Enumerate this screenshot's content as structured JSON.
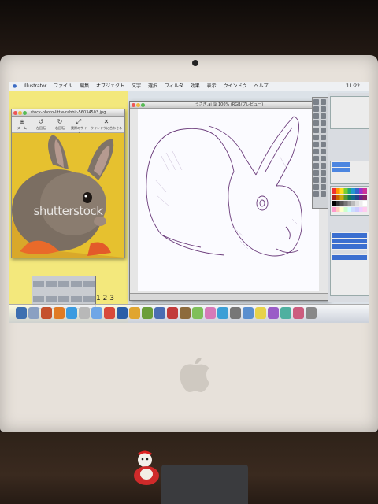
{
  "menubar": {
    "app_name": "Illustrator",
    "items": [
      "ファイル",
      "編集",
      "オブジェクト",
      "文字",
      "選択",
      "フィルタ",
      "効果",
      "表示",
      "ウインドウ",
      "ヘルプ"
    ],
    "clock": "11:22"
  },
  "photo_window": {
    "title": "stock-photo-little-rabbit-56034503.jpg",
    "toolbar_labels": [
      "ズーム",
      "左回転",
      "右回転",
      "実際のサイズ",
      "ウインドウに合わせる"
    ],
    "watermark": "shutterstock"
  },
  "artboard_window": {
    "title": "うさぎ.ai @ 100% (RGB/プレビュー)"
  },
  "page_numbers": [
    "1",
    "2",
    "3"
  ],
  "dock": {
    "icon_colors": [
      "#3d6fb0",
      "#8aa0c2",
      "#c5512c",
      "#e07b24",
      "#3b9be0",
      "#b8b8b8",
      "#6fa6e6",
      "#d84a3a",
      "#2a5ea8",
      "#e0a530",
      "#6b9e3a",
      "#4b6db3",
      "#c23b3b",
      "#8d6b3c",
      "#7fbf5a",
      "#d67ab8",
      "#3c9fd6",
      "#777777",
      "#5a8fcf",
      "#e7d24b",
      "#9a5cc7",
      "#4fb0a0",
      "#cc5c7e",
      "#888888"
    ]
  }
}
